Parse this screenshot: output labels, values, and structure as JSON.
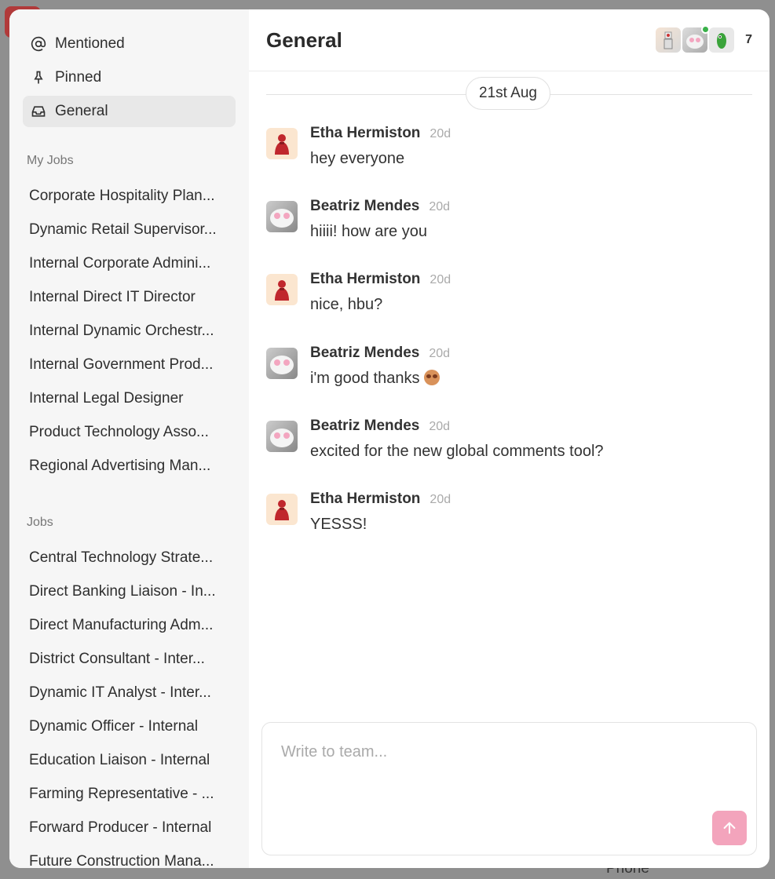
{
  "sidebar": {
    "nav": [
      {
        "label": "Mentioned",
        "icon": "at-icon"
      },
      {
        "label": "Pinned",
        "icon": "pin-icon"
      },
      {
        "label": "General",
        "icon": "inbox-icon",
        "active": true
      }
    ],
    "my_jobs_label": "My Jobs",
    "my_jobs": [
      "Corporate Hospitality Plan...",
      "Dynamic Retail Supervisor...",
      "Internal Corporate Admini...",
      "Internal Direct IT Director",
      "Internal Dynamic Orchestr...",
      "Internal Government Prod...",
      "Internal Legal Designer",
      "Product Technology Asso...",
      "Regional Advertising Man..."
    ],
    "jobs_label": "Jobs",
    "jobs": [
      "Central Technology Strate...",
      "Direct Banking Liaison - In...",
      "Direct Manufacturing Adm...",
      "District Consultant - Inter...",
      "Dynamic IT Analyst - Inter...",
      "Dynamic Officer - Internal",
      "Education Liaison - Internal",
      "Farming Representative - ...",
      "Forward Producer - Internal",
      "Future Construction Mana..."
    ]
  },
  "header": {
    "title": "General",
    "member_count": "7"
  },
  "date_separator": "21st Aug",
  "messages": [
    {
      "author": "Etha Hermiston",
      "time": "20d",
      "text": "hey everyone",
      "avatar": "etha"
    },
    {
      "author": "Beatriz Mendes",
      "time": "20d",
      "text": "hiiii! how are you",
      "avatar": "beatriz"
    },
    {
      "author": "Etha Hermiston",
      "time": "20d",
      "text": "nice, hbu?",
      "avatar": "etha"
    },
    {
      "author": "Beatriz Mendes",
      "time": "20d",
      "text": "i'm good thanks",
      "emoji": "star-struck-emoji",
      "avatar": "beatriz"
    },
    {
      "author": "Beatriz Mendes",
      "time": "20d",
      "text": "excited for the new global comments tool?",
      "avatar": "beatriz"
    },
    {
      "author": "Etha Hermiston",
      "time": "20d",
      "text": "YESSS!",
      "avatar": "etha"
    }
  ],
  "composer": {
    "placeholder": "Write to team...",
    "send_icon": "arrow-up-icon"
  },
  "background": {
    "phone_label": "Phone"
  },
  "colors": {
    "send_button": "#f3a4bc",
    "online": "#3ab14a",
    "active_nav": "#e8e8e8"
  }
}
